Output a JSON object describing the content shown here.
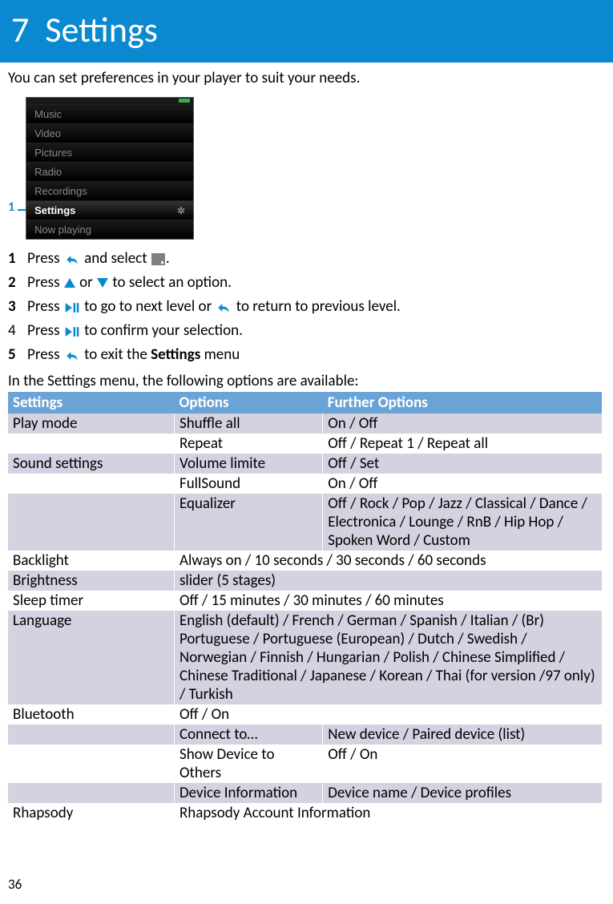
{
  "header": {
    "chapnum": "7",
    "title": "Settings"
  },
  "intro": "You can set preferences in your player to suit your needs.",
  "callout": "1",
  "device_menu": {
    "items": [
      "Music",
      "Video",
      "Pictures",
      "Radio",
      "Recordings"
    ],
    "highlighted": "Settings",
    "last": "Now playing"
  },
  "steps": [
    {
      "num": "1",
      "bold": true,
      "parts": [
        "Press ",
        {
          "icon": "back"
        },
        " and select ",
        {
          "icon": "greybox-dot"
        },
        "."
      ]
    },
    {
      "num": "2",
      "bold": true,
      "parts": [
        "Press ",
        {
          "icon": "tri-up"
        },
        " or ",
        {
          "icon": "tri-down"
        },
        " to select an option."
      ]
    },
    {
      "num": "3",
      "bold": true,
      "parts": [
        "Press ",
        {
          "icon": "playpause"
        },
        " to go to next level or ",
        {
          "icon": "back"
        },
        " to return to previous level."
      ]
    },
    {
      "num": "4",
      "bold": false,
      "parts": [
        "Press ",
        {
          "icon": "playpause"
        },
        " to confirm your selection."
      ]
    },
    {
      "num": "5",
      "bold": true,
      "parts": [
        "Press ",
        {
          "icon": "back"
        },
        " to exit the ",
        {
          "boldtext": "Settings"
        },
        " menu"
      ]
    }
  ],
  "table_intro": "In the Settings menu, the following options are available:",
  "table": {
    "headers": {
      "c1": "Settings",
      "c2": "Options",
      "c3": "Further Options"
    },
    "rows": [
      {
        "cls": "row-a",
        "c1": "Play mode",
        "c2": "Shuffle all",
        "c3": "On / Off"
      },
      {
        "cls": "row-b",
        "c1": "",
        "c2": "Repeat",
        "c3": "Off / Repeat 1 / Repeat all"
      },
      {
        "cls": "row-a",
        "c1": "Sound settings",
        "c2": "Volume limite",
        "c3": "Off / Set"
      },
      {
        "cls": "row-b",
        "c1": "",
        "c2": "FullSound",
        "c3": "On / Off"
      },
      {
        "cls": "row-a",
        "c1": "",
        "c2": "Equalizer",
        "c3": "Off / Rock / Pop / Jazz / Classical / Dance / Electronica / Lounge / RnB / Hip Hop / Spoken Word / Custom"
      },
      {
        "cls": "row-b",
        "c1": "Backlight",
        "c2": "Always on / 10 seconds / 30 seconds / 60 seconds",
        "c3": "",
        "span2": true
      },
      {
        "cls": "row-a",
        "c1": "Brightness",
        "c2": "slider (5 stages)",
        "c3": "",
        "span2": true
      },
      {
        "cls": "row-b",
        "c1": "Sleep timer",
        "c2": "Off / 15 minutes / 30 minutes / 60 minutes",
        "c3": "",
        "span2": true
      },
      {
        "cls": "row-a",
        "c1": "Language",
        "c2": "English (default) / French / German / Spanish / Italian / (Br) Portuguese / Portuguese (European) / Dutch / Swedish / Norwegian / Finnish / Hungarian / Polish / Chinese Simplified / Chinese Traditional / Japanese / Korean / Thai (for version /97 only) / Turkish",
        "c3": "",
        "span2": true
      },
      {
        "cls": "row-b",
        "c1": "Bluetooth",
        "c2": "Off / On",
        "c3": "",
        "span2": true
      },
      {
        "cls": "row-a",
        "c1": "",
        "c2": "Connect to…",
        "c3": "New device / Paired device (list)"
      },
      {
        "cls": "row-b",
        "c1": "",
        "c2": "Show Device to Others",
        "c3": "Off / On"
      },
      {
        "cls": "row-a",
        "c1": "",
        "c2": "Device Information",
        "c3": "Device name / Device profiles"
      },
      {
        "cls": "row-b",
        "c1": "Rhapsody",
        "c2": "Rhapsody Account Information",
        "c3": "",
        "span2": true
      }
    ]
  },
  "pagenum": "36"
}
